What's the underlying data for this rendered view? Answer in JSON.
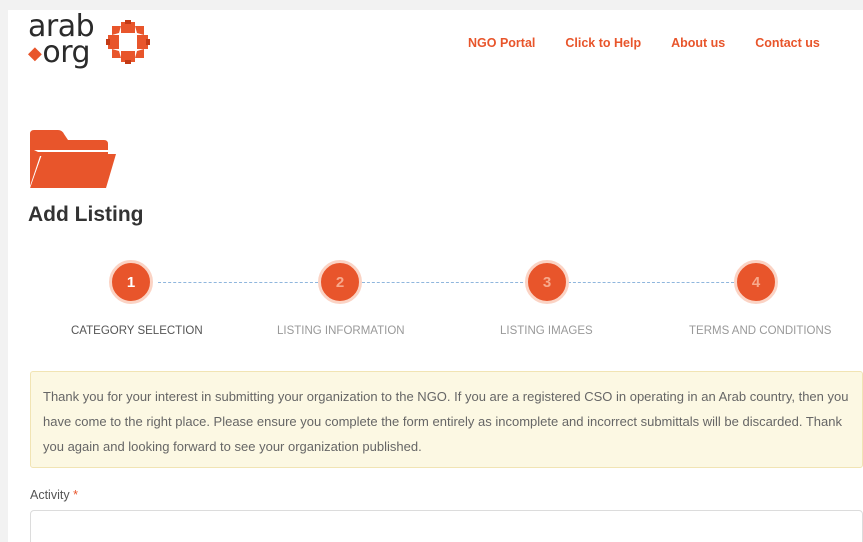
{
  "header": {
    "logo": {
      "line1": "arab",
      "line2": "org"
    },
    "nav": [
      {
        "label": "NGO Portal"
      },
      {
        "label": "Click to Help"
      },
      {
        "label": "About us"
      },
      {
        "label": "Contact us"
      }
    ]
  },
  "page": {
    "title": "Add Listing",
    "icon": "folder-icon"
  },
  "steps": [
    {
      "number": "1",
      "label": "CATEGORY SELECTION",
      "active": true
    },
    {
      "number": "2",
      "label": "LISTING INFORMATION",
      "active": false
    },
    {
      "number": "3",
      "label": "LISTING IMAGES",
      "active": false
    },
    {
      "number": "4",
      "label": "TERMS AND CONDITIONS",
      "active": false
    }
  ],
  "notice": {
    "text": "Thank you for your interest in submitting your organization to the NGO. If you are a registered CSO in operating in an Arab country, then you have come to the right place. Please ensure you complete the form entirely as incomplete and incorrect submittals will be discarded. Thank you again and looking forward to see your organization published."
  },
  "form": {
    "activity": {
      "label": "Activity",
      "required_mark": "*",
      "value": ""
    }
  },
  "colors": {
    "accent": "#e8552b",
    "notice_bg": "#fcf8e3",
    "step_line": "#8fb6dd"
  }
}
